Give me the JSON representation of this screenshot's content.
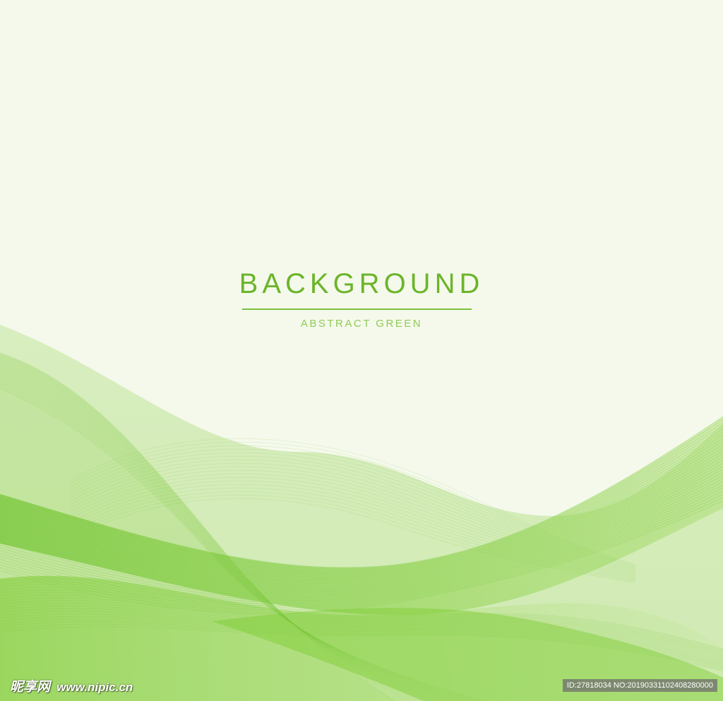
{
  "heading": {
    "title": "BACKGROUND",
    "subtitle": "ABSTRACT GREEN"
  },
  "watermark": {
    "logo_text": "昵享网",
    "url": "www.nipic.cn",
    "id_text": "ID:27818034 NO:20190331102408280000"
  },
  "colors": {
    "background": "#f5f9ec",
    "title": "#6cb52a",
    "subtitle": "#8fcc55",
    "wave_dark": "#6cc22a",
    "wave_light": "#a8dc70"
  }
}
